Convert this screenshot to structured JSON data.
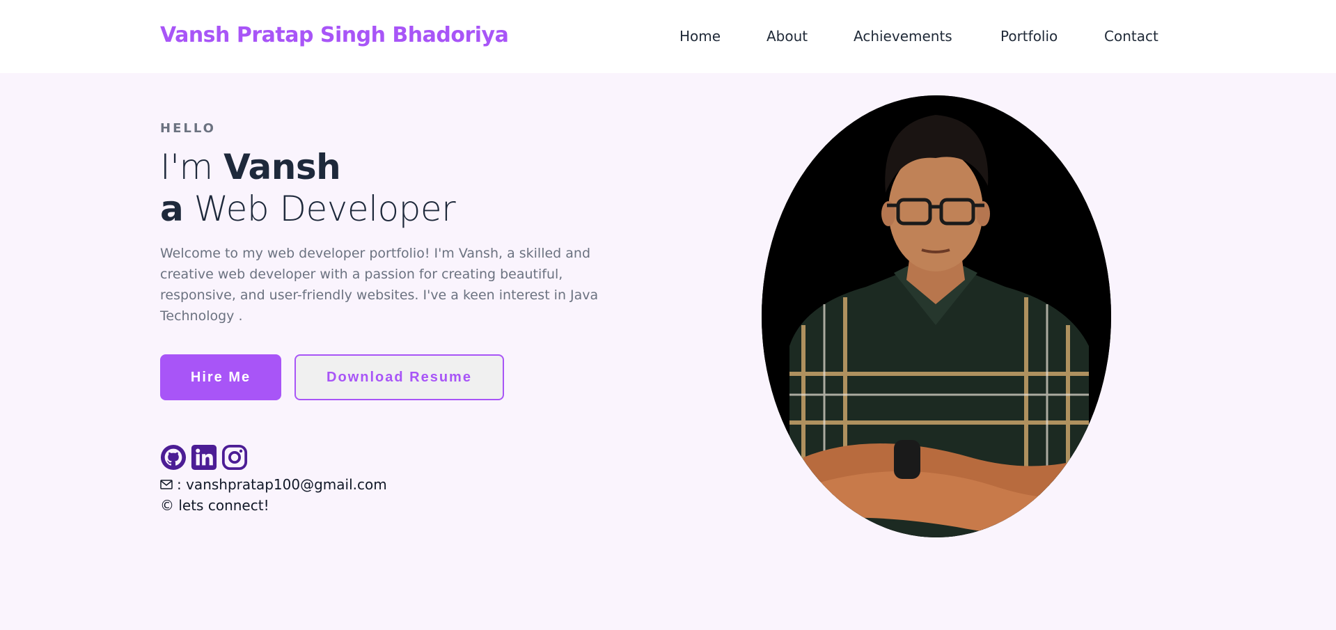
{
  "header": {
    "brand": "Vansh Pratap Singh Bhadoriya",
    "nav": [
      "Home",
      "About",
      "Achievements",
      "Portfolio",
      "Contact"
    ]
  },
  "hero": {
    "greeting": "HELLO",
    "line1_prefix": "I'm ",
    "name": "Vansh",
    "line2_prefix": "a",
    "role": " Web Developer",
    "intro": "Welcome to my web developer portfolio! I'm Vansh, a skilled and creative web developer with a passion for creating beautiful, responsive, and user-friendly websites. I've a keen interest in Java Technology .",
    "hire_label": "Hire Me",
    "resume_label": "Download Resume",
    "email": " : vanshpratap100@gmail.com",
    "connect": "© lets connect!"
  },
  "socials": [
    "github-icon",
    "linkedin-icon",
    "instagram-icon"
  ],
  "colors": {
    "accent": "#a855f7",
    "icon": "#4c1d95",
    "background": "#faf4fd",
    "text_dark": "#1e293b",
    "text_muted": "#6b7280"
  }
}
